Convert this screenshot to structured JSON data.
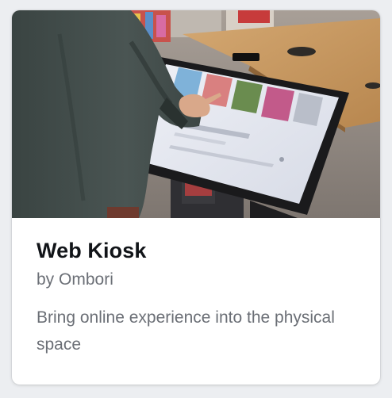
{
  "card": {
    "title": "Web Kiosk",
    "author": "by Ombori",
    "description": "Bring online experience into the physical space",
    "image_alt_subject": "person using touchscreen kiosk"
  },
  "colors": {
    "page_background": "#eceef1",
    "card_background": "#ffffff",
    "title": "#111418",
    "secondary_text": "#6b6f76"
  }
}
